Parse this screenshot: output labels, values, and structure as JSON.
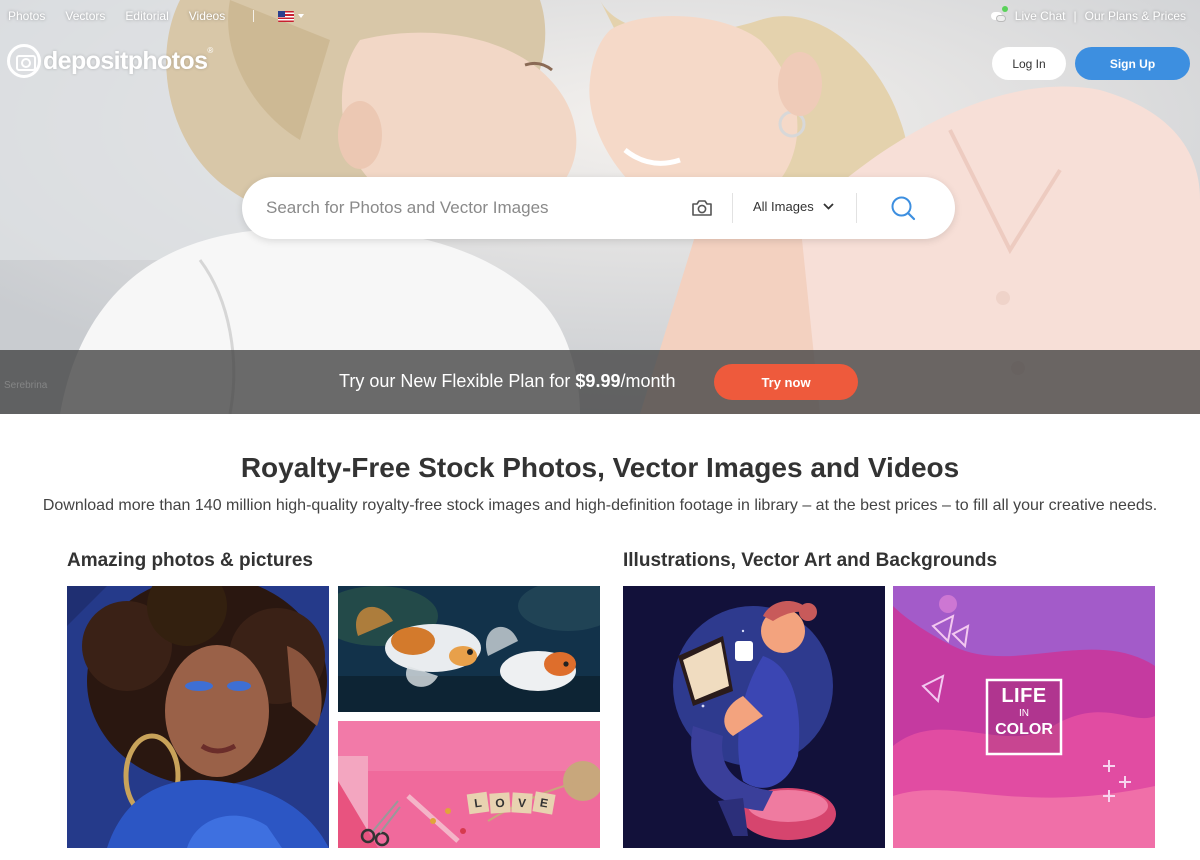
{
  "nav": {
    "links": [
      "Photos",
      "Vectors",
      "Editorial",
      "Videos"
    ],
    "live_chat": "Live Chat",
    "separator": "|",
    "plans": "Our Plans & Prices"
  },
  "brand": {
    "name": "depositphotos",
    "reg": "®"
  },
  "auth": {
    "login": "Log In",
    "signup": "Sign Up"
  },
  "search": {
    "placeholder": "Search for Photos and Vector Images",
    "type_selected": "All Images"
  },
  "promo": {
    "prefix": "Try our New Flexible Plan for ",
    "price": "$9.99",
    "suffix": "/month",
    "cta": "Try now",
    "credit": "Serebrina"
  },
  "hero_headline": {
    "title": "Royalty-Free Stock Photos, Vector Images and Videos",
    "subtitle": "Download more than 140 million high-quality royalty-free stock images and high-definition footage in library – at the best prices – to fill all your creative needs."
  },
  "sections": [
    {
      "title": "Amazing photos & pictures"
    },
    {
      "title": "Illustrations, Vector Art and Backgrounds"
    }
  ],
  "tiles": {
    "love_letters": [
      "L",
      "O",
      "V",
      "E"
    ],
    "life_in_color": [
      "LIFE",
      "IN",
      "COLOR"
    ]
  },
  "colors": {
    "accent_blue": "#3d8fe0",
    "cta_orange": "#ee5a3c",
    "heading": "#333333"
  }
}
